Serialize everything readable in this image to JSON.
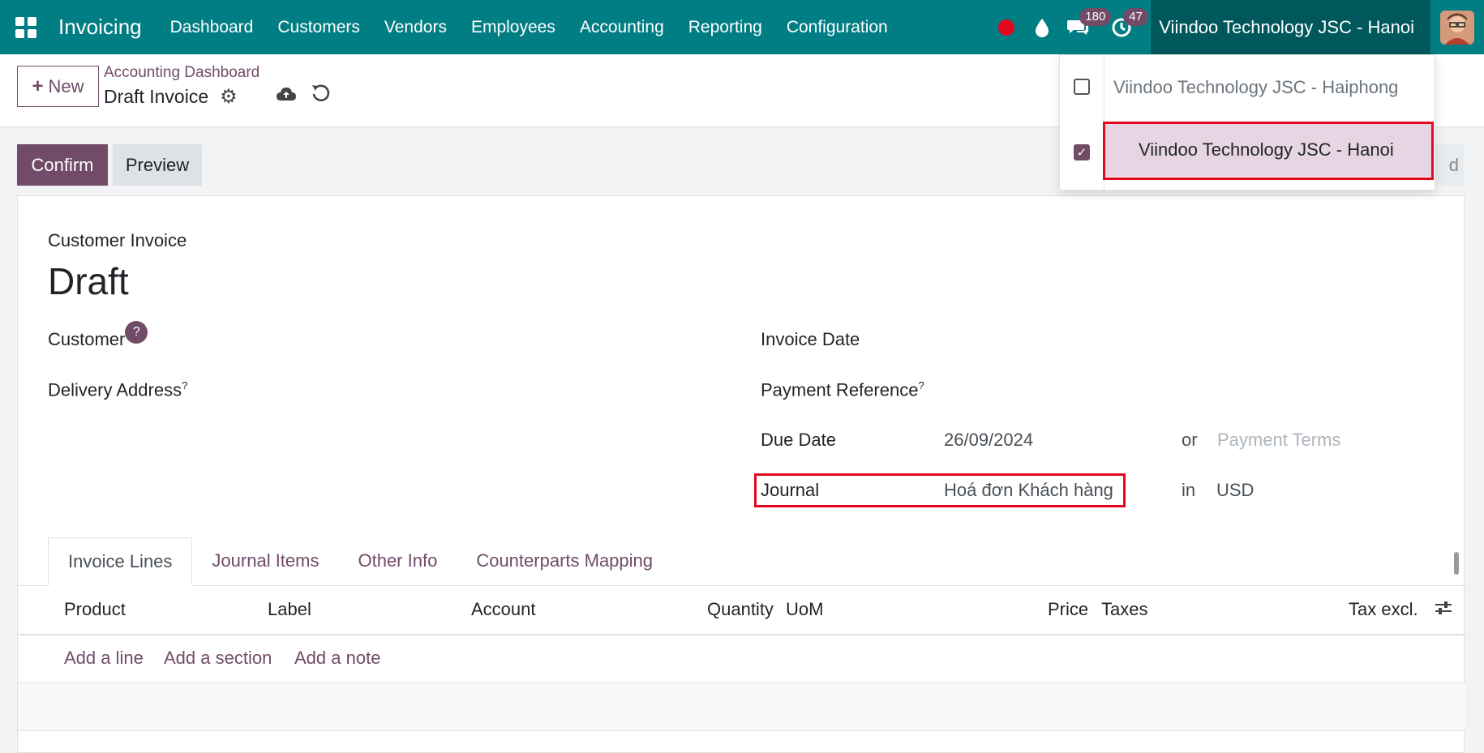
{
  "navbar": {
    "app_name": "Invoicing",
    "menu": [
      "Dashboard",
      "Customers",
      "Vendors",
      "Employees",
      "Accounting",
      "Reporting",
      "Configuration"
    ],
    "messages_count": "180",
    "activities_count": "47",
    "current_company": "Viindoo Technology JSC - Hanoi"
  },
  "control_panel": {
    "new_label": "New",
    "breadcrumb": "Accounting Dashboard",
    "record_title": "Draft Invoice"
  },
  "status_bar": {
    "confirm_label": "Confirm",
    "preview_label": "Preview",
    "partial_right_label": "d"
  },
  "form": {
    "subtitle": "Customer Invoice",
    "title": "Draft",
    "customer_label": "Customer",
    "customer_help": "?",
    "delivery_label": "Delivery Address",
    "delivery_sup": "?",
    "invoice_date_label": "Invoice Date",
    "payment_ref_label": "Payment Reference",
    "payment_ref_sup": "?",
    "due_date_label": "Due Date",
    "due_date_value": "26/09/2024",
    "or_label": "or",
    "payment_terms_placeholder": "Payment Terms",
    "journal_label": "Journal",
    "journal_value": "Hoá đơn Khách hàng",
    "in_label": "in",
    "currency_value": "USD"
  },
  "tabs": [
    "Invoice Lines",
    "Journal Items",
    "Other Info",
    "Counterparts Mapping"
  ],
  "table": {
    "columns": [
      "Product",
      "Label",
      "Account",
      "Quantity",
      "UoM",
      "Price",
      "Taxes",
      "Tax excl."
    ],
    "add_line": "Add a line",
    "add_section": "Add a section",
    "add_note": "Add a note"
  },
  "company_dropdown": {
    "items": [
      {
        "label": "Viindoo Technology JSC - Haiphong",
        "checked": false
      },
      {
        "label": "Viindoo Technology JSC - Hanoi",
        "checked": true
      }
    ]
  },
  "colors": {
    "navbar": "#017e84",
    "primary": "#714b67",
    "highlight": "#e4081f"
  }
}
